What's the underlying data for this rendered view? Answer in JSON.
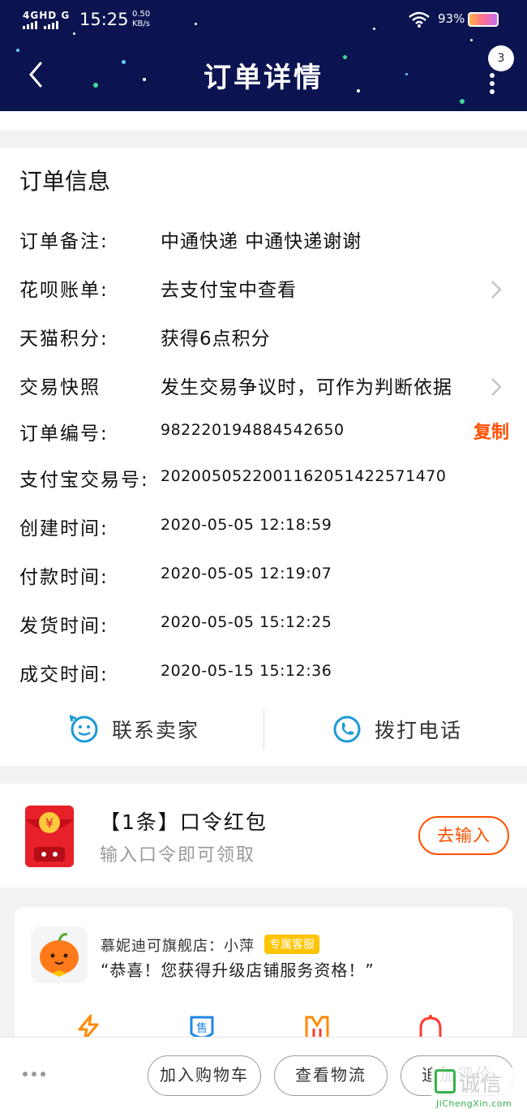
{
  "status_bar": {
    "network": "4GHD G",
    "time": "15:25",
    "speed_value": "0.50",
    "speed_unit": "KB/s",
    "battery": "93%"
  },
  "nav": {
    "title": "订单详情",
    "badge": "3",
    "back_icon": "chevron-left-icon",
    "more_icon": "more-vertical-icon"
  },
  "order": {
    "section_title": "订单信息",
    "rows": [
      {
        "label": "订单备注:",
        "value": "中通快递 中通快递谢谢"
      },
      {
        "label": "花呗账单:",
        "value": "去支付宝中查看",
        "chevron": true
      },
      {
        "label": "天猫积分:",
        "value": "获得6点积分"
      },
      {
        "label": "交易快照",
        "value": "发生交易争议时，可作为判断依据",
        "chevron": true
      },
      {
        "label": "订单编号:",
        "value": "982220194884542650",
        "action": "复制"
      },
      {
        "label": "支付宝交易号:",
        "value": "2020050522001162051422571470"
      },
      {
        "label": "创建时间:",
        "value": "2020-05-05 12:18:59"
      },
      {
        "label": "付款时间:",
        "value": "2020-05-05 12:19:07"
      },
      {
        "label": "发货时间:",
        "value": "2020-05-05 15:12:25"
      },
      {
        "label": "成交时间:",
        "value": "2020-05-15 15:12:36"
      }
    ],
    "contact_seller": "联系卖家",
    "call_phone": "拨打电话"
  },
  "red_packet": {
    "title": "【1条】口令红包",
    "subtitle": "输入口令即可领取",
    "button": "去输入"
  },
  "shop": {
    "name": "慕妮迪可旗舰店：小萍",
    "tag": "专属客服",
    "message": "“恭喜！您获得升级店铺服务资格！”",
    "icons": [
      "lightning-icon",
      "sale-icon",
      "store-icon",
      "bell-icon"
    ],
    "colors": {
      "orange": "#ff8a00",
      "blue": "#1e88e5",
      "red": "#ff3b30"
    }
  },
  "bottom_bar": {
    "add_to_cart": "加入购物车",
    "view_logistics": "查看物流",
    "add_review": "追加评价"
  },
  "watermark": {
    "text": "诚信",
    "url": "JiChengXin.com"
  },
  "colors": {
    "header_bg": "#0b1450",
    "accent": "#ff5000",
    "page_bg": "#f2f2f2"
  }
}
